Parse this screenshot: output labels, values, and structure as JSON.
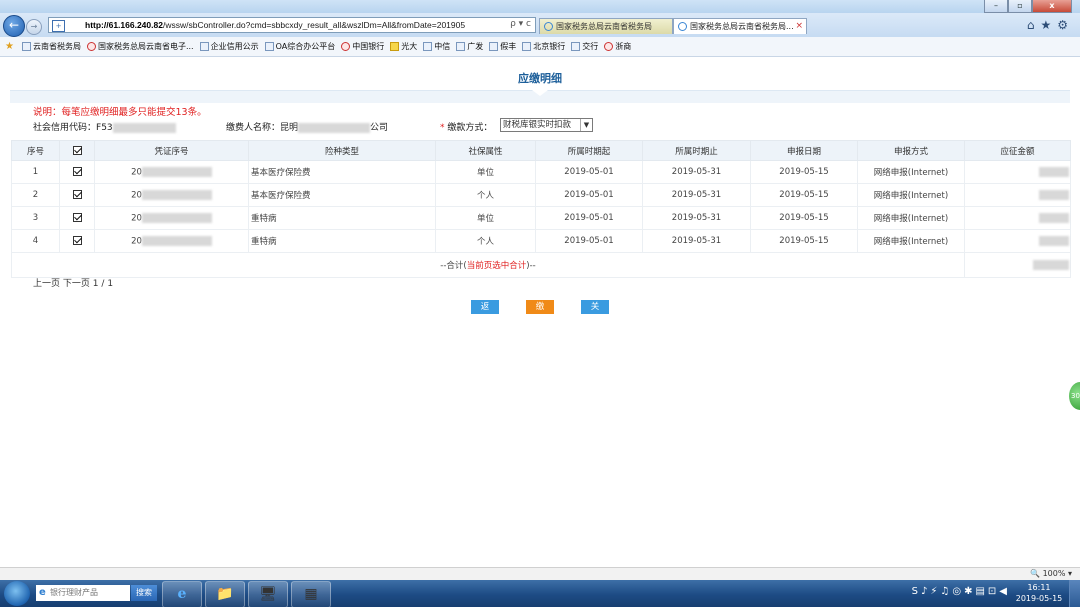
{
  "browser": {
    "window_controls": {
      "minimize": "–",
      "restore": "▫",
      "close": "x"
    },
    "address": "http://61.166.240.82/wssw/sbController.do?cmd=sbbcxdy_result_all&wszlDm=All&fromDate=201905",
    "address_host": "http://61.166.240.82",
    "address_path": "/wssw/sbController.do?cmd=sbbcxdy_result_all&wszlDm=All&fromDate=201905",
    "address_tools": "ρ ▾ c",
    "tabs": [
      {
        "label": "国家税务总局云南省税务局"
      },
      {
        "label": "国家税务总局云南省税务局..."
      }
    ],
    "tab_close": "×",
    "favorites": [
      "云南省税务局",
      "国家税务总局云南省电子...",
      "企业信用公示",
      "OA综合办公平台",
      "中国银行",
      "光大",
      "中信",
      "广发",
      "假丰",
      "北京银行",
      "交行",
      "浙商"
    ]
  },
  "page": {
    "title": "应缴明细",
    "notice": "说明：每笔应缴明细最多只能提交13条。",
    "credit_code_label": "社会信用代码：",
    "credit_code_prefix": "F53",
    "payer_label": "缴费人名称：",
    "payer_prefix": "昆明",
    "payer_suffix": "公司",
    "payment_method_label": "缴款方式：",
    "payment_method_required": "*",
    "payment_method_value": "财税库银实时扣款"
  },
  "table": {
    "headers": [
      "序号",
      "",
      "凭证序号",
      "险种类型",
      "社保属性",
      "所属时期起",
      "所属时期止",
      "申报日期",
      "申报方式",
      "应征金额"
    ],
    "rows": [
      {
        "no": "1",
        "voucher": "20",
        "insurance": "基本医疗保险费",
        "attr": "单位",
        "start": "2019-05-01",
        "end": "2019-05-31",
        "declare_date": "2019-05-15",
        "method": "网络申报(Internet)"
      },
      {
        "no": "2",
        "voucher": "20",
        "insurance": "基本医疗保险费",
        "attr": "个人",
        "start": "2019-05-01",
        "end": "2019-05-31",
        "declare_date": "2019-05-15",
        "method": "网络申报(Internet)"
      },
      {
        "no": "3",
        "voucher": "20",
        "insurance": "重特病",
        "attr": "单位",
        "start": "2019-05-01",
        "end": "2019-05-31",
        "declare_date": "2019-05-15",
        "method": "网络申报(Internet)"
      },
      {
        "no": "4",
        "voucher": "20",
        "insurance": "重特病",
        "attr": "个人",
        "start": "2019-05-01",
        "end": "2019-05-31",
        "declare_date": "2019-05-15",
        "method": "网络申报(Internet)"
      }
    ],
    "total_prefix": "--合计(",
    "total_highlight": "当前页选中合计",
    "total_suffix": ")--"
  },
  "pager": {
    "prev": "上一页",
    "next": "下一页",
    "current": "1",
    "separator": "/",
    "total": "1"
  },
  "buttons": {
    "back": "返回",
    "pay": "缴款",
    "close": "关闭"
  },
  "floater_label": "30",
  "status": {
    "zoom": "100%"
  },
  "taskbar": {
    "search_placeholder": "银行理财产品",
    "search_button": "搜索",
    "time": "16:11",
    "date": "2019-05-15"
  },
  "colors": {
    "title": "#1d5f9a",
    "notice": "#e02020",
    "btn_blue": "#3a9be0",
    "btn_orange": "#f08a17"
  }
}
